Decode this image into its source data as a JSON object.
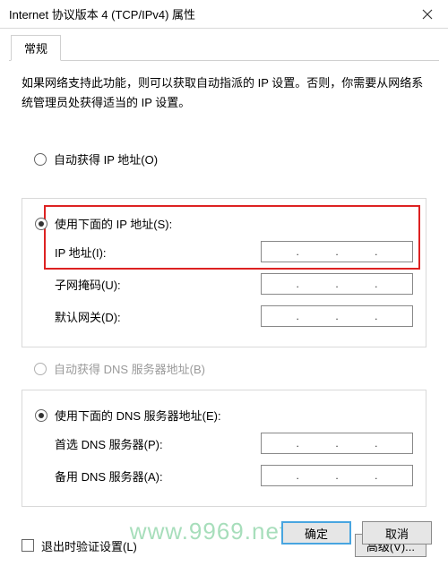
{
  "window": {
    "title": "Internet 协议版本 4 (TCP/IPv4) 属性"
  },
  "tabs": {
    "general": "常规"
  },
  "description": "如果网络支持此功能，则可以获取自动指派的 IP 设置。否则，你需要从网络系统管理员处获得适当的 IP 设置。",
  "ip": {
    "auto_label": "自动获得 IP 地址(O)",
    "manual_label": "使用下面的 IP 地址(S):",
    "address_label": "IP 地址(I):",
    "subnet_label": "子网掩码(U):",
    "gateway_label": "默认网关(D):"
  },
  "dns": {
    "auto_label": "自动获得 DNS 服务器地址(B)",
    "manual_label": "使用下面的 DNS 服务器地址(E):",
    "preferred_label": "首选 DNS 服务器(P):",
    "alternate_label": "备用 DNS 服务器(A):"
  },
  "validate_label": "退出时验证设置(L)",
  "buttons": {
    "advanced": "高级(V)...",
    "ok": "确定",
    "cancel": "取消"
  },
  "watermark": "www.9969.net"
}
